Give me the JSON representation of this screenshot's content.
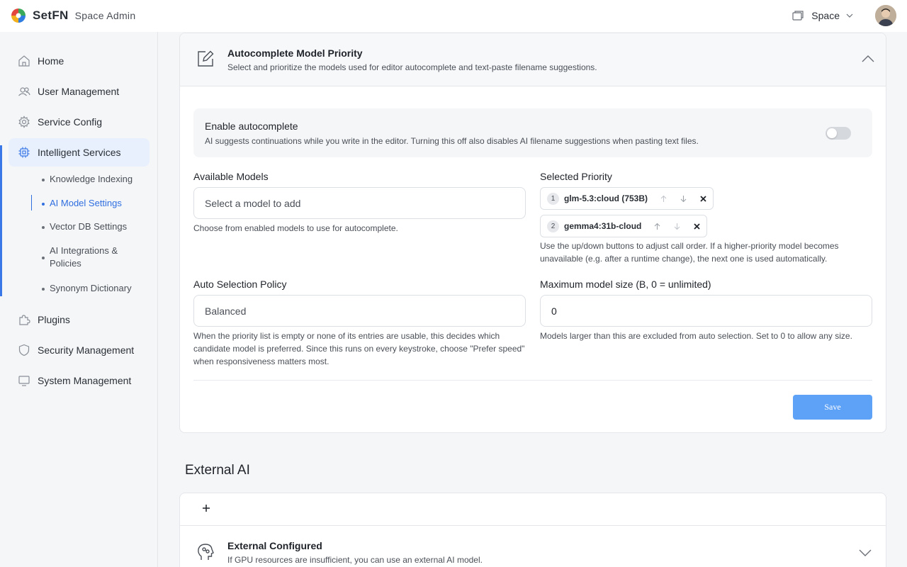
{
  "app": {
    "brand_name": "SetFN",
    "brand_sub": "Space Admin",
    "space_label": "Space"
  },
  "sidebar": {
    "items": [
      {
        "label": "Home",
        "icon": "home-icon"
      },
      {
        "label": "User Management",
        "icon": "users-icon"
      },
      {
        "label": "Service Config",
        "icon": "gear-icon"
      },
      {
        "label": "Intelligent Services",
        "icon": "chip-icon"
      },
      {
        "label": "Plugins",
        "icon": "puzzle-icon"
      },
      {
        "label": "Security Management",
        "icon": "shield-icon"
      },
      {
        "label": "System Management",
        "icon": "monitor-icon"
      }
    ],
    "subitems": [
      {
        "label": "Knowledge Indexing"
      },
      {
        "label": "AI Model Settings"
      },
      {
        "label": "Vector DB Settings"
      },
      {
        "label": "AI Integrations & Policies"
      },
      {
        "label": "Synonym Dictionary"
      }
    ]
  },
  "autocomplete": {
    "title": "Autocomplete Model Priority",
    "desc": "Select and prioritize the models used for editor autocomplete and text-paste filename suggestions.",
    "enable_title": "Enable autocomplete",
    "enable_desc": "AI suggests continuations while you write in the editor. Turning this off also disables AI filename suggestions when pasting text files.",
    "enabled": false,
    "available_label": "Available Models",
    "available_placeholder": "Select a model to add",
    "available_help": "Choose from enabled models to use for autocomplete.",
    "priority_label": "Selected Priority",
    "priority": [
      {
        "num": "1",
        "name": "glm-5.3:cloud (753B)"
      },
      {
        "num": "2",
        "name": "gemma4:31b-cloud"
      }
    ],
    "priority_help": "Use the up/down buttons to adjust call order. If a higher-priority model becomes unavailable (e.g. after a runtime change), the next one is used automatically.",
    "policy_label": "Auto Selection Policy",
    "policy_value": "Balanced",
    "policy_help": "When the priority list is empty or none of its entries are usable, this decides which candidate model is preferred. Since this runs on every keystroke, choose \"Prefer speed\" when responsiveness matters most.",
    "maxsize_label": "Maximum model size (B, 0 = unlimited)",
    "maxsize_value": "0",
    "maxsize_help": "Models larger than this are excluded from auto selection. Set to 0 to allow any size.",
    "save_label": "Save"
  },
  "external": {
    "section_title": "External AI",
    "add_symbol": "+",
    "title": "External Configured",
    "desc": "If GPU resources are insufficient, you can use an external AI model."
  },
  "colors": {
    "accent": "#3b78e7",
    "save": "#5ea2f7"
  }
}
